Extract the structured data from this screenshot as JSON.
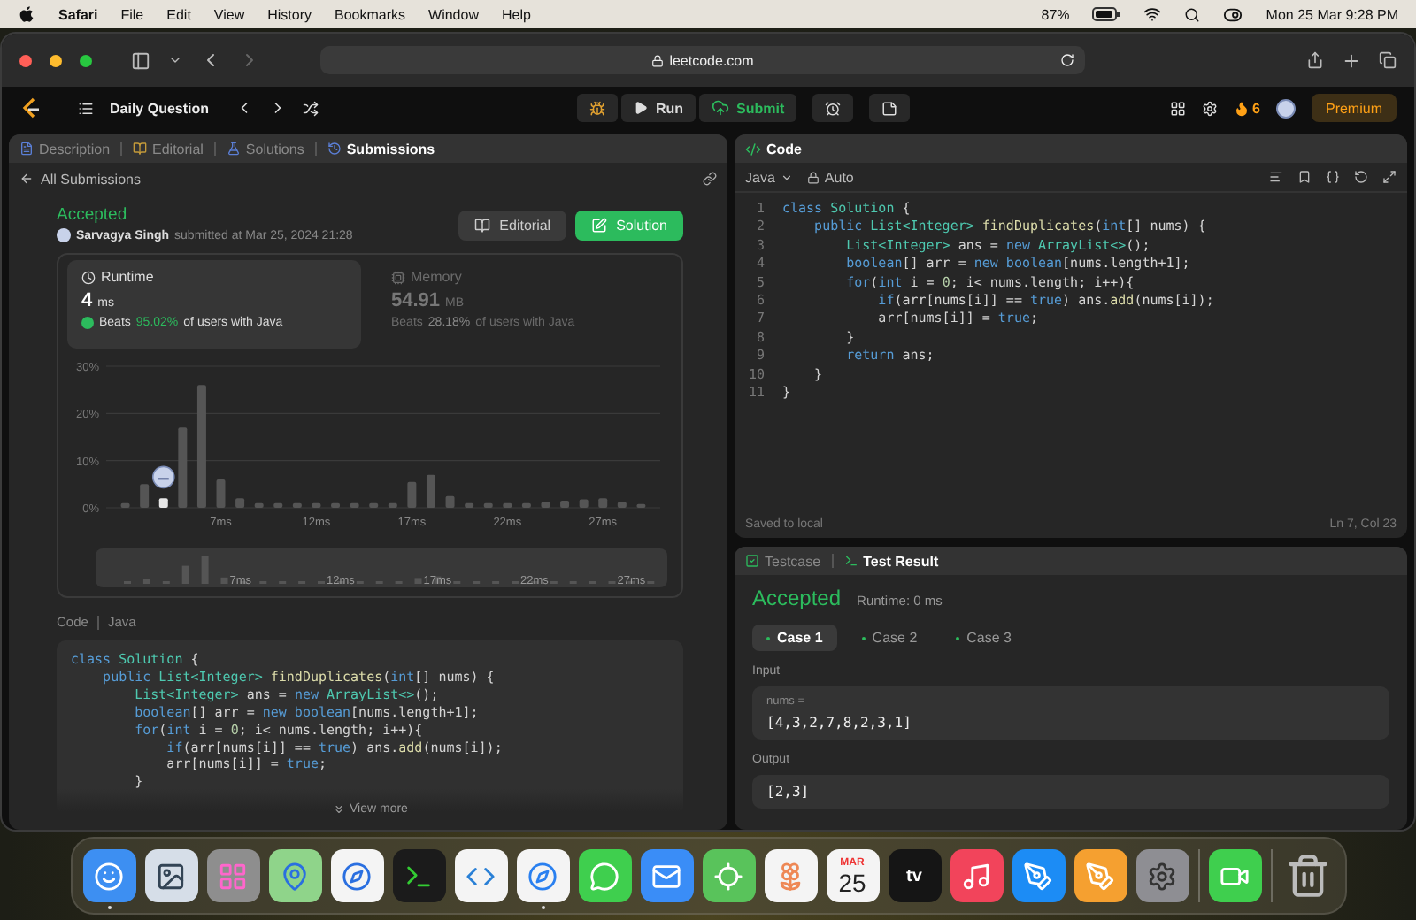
{
  "menu_bar": {
    "app": "Safari",
    "items": [
      "File",
      "Edit",
      "View",
      "History",
      "Bookmarks",
      "Window",
      "Help"
    ],
    "battery": "87%",
    "clock": "Mon 25 Mar  9:28 PM"
  },
  "browser": {
    "url": "leetcode.com"
  },
  "nav": {
    "title": "Daily Question",
    "run": "Run",
    "submit": "Submit",
    "streak": "6",
    "premium": "Premium"
  },
  "left_tabs": [
    {
      "label": "Description",
      "kind": "description",
      "selected": false
    },
    {
      "label": "Editorial",
      "kind": "editorial",
      "selected": false
    },
    {
      "label": "Solutions",
      "kind": "solutions",
      "selected": false
    },
    {
      "label": "Submissions",
      "kind": "submissions",
      "selected": true
    }
  ],
  "back_link": "All Submissions",
  "submission": {
    "status": "Accepted",
    "author": "Sarvagya Singh",
    "submitted": "submitted at Mar 25, 2024 21:28",
    "buttons": [
      {
        "label": "Editorial",
        "kind": "editorial"
      },
      {
        "label": "Solution",
        "kind": "solution"
      }
    ]
  },
  "metrics": [
    {
      "kind": "runtime",
      "label": "Runtime",
      "value": "4",
      "unit": "ms",
      "beats_label": "Beats",
      "beats": "95.02%",
      "suffix": "of users with Java",
      "selected": true
    },
    {
      "kind": "memory",
      "label": "Memory",
      "value": "54.91",
      "unit": "MB",
      "beats_label": "Beats",
      "beats": "28.18%",
      "suffix": "of users with Java",
      "selected": false
    }
  ],
  "chart_data": {
    "type": "bar",
    "x": [
      2,
      3,
      4,
      5,
      6,
      7,
      8,
      9,
      10,
      11,
      12,
      13,
      14,
      15,
      16,
      17,
      18,
      19,
      20,
      21,
      22,
      23,
      24,
      25,
      26,
      27,
      28,
      29
    ],
    "values": [
      1,
      5,
      2,
      17,
      26,
      6,
      2,
      1,
      1,
      1,
      1,
      1,
      1,
      1,
      1,
      5.5,
      7,
      2.5,
      1,
      1,
      1,
      1,
      1.2,
      1.5,
      1.8,
      2,
      1.2,
      0.8
    ],
    "xlim": [
      1,
      30
    ],
    "ylim": [
      0,
      30
    ],
    "yticks": [
      {
        "value": 0,
        "label": "0%"
      },
      {
        "value": 10,
        "label": "10%"
      },
      {
        "value": 20,
        "label": "20%"
      },
      {
        "value": 30,
        "label": "30%"
      }
    ],
    "xticks": [
      {
        "value": 7,
        "label": "7ms"
      },
      {
        "value": 12,
        "label": "12ms"
      },
      {
        "value": 17,
        "label": "17ms"
      },
      {
        "value": 22,
        "label": "22ms"
      },
      {
        "value": 27,
        "label": "27ms"
      }
    ]
  },
  "overview_labels": [
    "7ms",
    "12ms",
    "17ms",
    "22ms",
    "27ms"
  ],
  "code_preview": {
    "label": "Code",
    "language": "Java",
    "view_more": "View more",
    "lines": [
      [
        {
          "kind": "kw",
          "text": "class "
        },
        {
          "kind": "type",
          "text": "Solution"
        },
        {
          "kind": "p",
          "text": " {"
        }
      ],
      [
        {
          "kind": "kw",
          "text": "    public "
        },
        {
          "kind": "type",
          "text": "List<Integer> "
        },
        {
          "kind": "fn",
          "text": "findDuplicates"
        },
        {
          "kind": "p",
          "text": "("
        },
        {
          "kind": "kw",
          "text": "int"
        },
        {
          "kind": "p",
          "text": "[] nums) {"
        }
      ],
      [
        {
          "kind": "type",
          "text": "        List<Integer>"
        },
        {
          "kind": "p",
          "text": " ans = "
        },
        {
          "kind": "kw",
          "text": "new "
        },
        {
          "kind": "type",
          "text": "ArrayList<>"
        },
        {
          "kind": "p",
          "text": "();"
        }
      ],
      [
        {
          "kind": "kw",
          "text": "        boolean"
        },
        {
          "kind": "p",
          "text": "[] arr = "
        },
        {
          "kind": "kw",
          "text": "new boolean"
        },
        {
          "kind": "p",
          "text": "[nums.length+1];"
        }
      ],
      [
        {
          "kind": "kw",
          "text": "        for"
        },
        {
          "kind": "p",
          "text": "("
        },
        {
          "kind": "kw",
          "text": "int"
        },
        {
          "kind": "p",
          "text": " i = "
        },
        {
          "kind": "num",
          "text": "0"
        },
        {
          "kind": "p",
          "text": "; i< nums.length; i++){"
        }
      ],
      [
        {
          "kind": "kw",
          "text": "            if"
        },
        {
          "kind": "p",
          "text": "(arr[nums[i]] == "
        },
        {
          "kind": "kw",
          "text": "true"
        },
        {
          "kind": "p",
          "text": ") ans."
        },
        {
          "kind": "fn",
          "text": "add"
        },
        {
          "kind": "p",
          "text": "(nums[i]);"
        }
      ],
      [
        {
          "kind": "p",
          "text": "            arr[nums[i]] = "
        },
        {
          "kind": "kw",
          "text": "true"
        },
        {
          "kind": "p",
          "text": ";"
        }
      ],
      [
        {
          "kind": "p",
          "text": "        }"
        }
      ]
    ]
  },
  "editor": {
    "title": "Code",
    "language": "Java",
    "mode": "Auto",
    "saved": "Saved to local",
    "cursor": "Ln 7, Col 23",
    "lines": [
      {
        "no": "1",
        "tokens": [
          {
            "kind": "kw",
            "text": "class "
          },
          {
            "kind": "type",
            "text": "Solution"
          },
          {
            "kind": "p",
            "text": " {"
          }
        ]
      },
      {
        "no": "2",
        "tokens": [
          {
            "kind": "kw",
            "text": "    public "
          },
          {
            "kind": "type",
            "text": "List<Integer> "
          },
          {
            "kind": "fn",
            "text": "findDuplicates"
          },
          {
            "kind": "p",
            "text": "("
          },
          {
            "kind": "kw",
            "text": "int"
          },
          {
            "kind": "p",
            "text": "[] nums) {"
          }
        ]
      },
      {
        "no": "3",
        "tokens": [
          {
            "kind": "type",
            "text": "        List<Integer>"
          },
          {
            "kind": "p",
            "text": " ans = "
          },
          {
            "kind": "kw",
            "text": "new "
          },
          {
            "kind": "type",
            "text": "ArrayList<>"
          },
          {
            "kind": "p",
            "text": "();"
          }
        ]
      },
      {
        "no": "4",
        "tokens": [
          {
            "kind": "kw",
            "text": "        boolean"
          },
          {
            "kind": "p",
            "text": "[] arr = "
          },
          {
            "kind": "kw",
            "text": "new boolean"
          },
          {
            "kind": "p",
            "text": "[nums.length+1];"
          }
        ]
      },
      {
        "no": "5",
        "tokens": [
          {
            "kind": "kw",
            "text": "        for"
          },
          {
            "kind": "p",
            "text": "("
          },
          {
            "kind": "kw",
            "text": "int"
          },
          {
            "kind": "p",
            "text": " i = "
          },
          {
            "kind": "num",
            "text": "0"
          },
          {
            "kind": "p",
            "text": "; i< nums.length; i++){"
          }
        ]
      },
      {
        "no": "6",
        "tokens": [
          {
            "kind": "kw",
            "text": "            if"
          },
          {
            "kind": "p",
            "text": "(arr[nums[i]] == "
          },
          {
            "kind": "kw",
            "text": "true"
          },
          {
            "kind": "p",
            "text": ") ans."
          },
          {
            "kind": "fn",
            "text": "add"
          },
          {
            "kind": "p",
            "text": "(nums[i]);"
          }
        ]
      },
      {
        "no": "7",
        "tokens": [
          {
            "kind": "p",
            "text": "            arr[nums[i]] = "
          },
          {
            "kind": "kw",
            "text": "true"
          },
          {
            "kind": "p",
            "text": ";"
          }
        ]
      },
      {
        "no": "8",
        "tokens": [
          {
            "kind": "p",
            "text": "        }"
          }
        ]
      },
      {
        "no": "9",
        "tokens": [
          {
            "kind": "kw",
            "text": "        return"
          },
          {
            "kind": "p",
            "text": " ans;"
          }
        ]
      },
      {
        "no": "10",
        "tokens": [
          {
            "kind": "p",
            "text": "    }"
          }
        ]
      },
      {
        "no": "11",
        "tokens": [
          {
            "kind": "p",
            "text": "}"
          }
        ]
      }
    ]
  },
  "result": {
    "tabs": [
      {
        "label": "Testcase",
        "kind": "testcase",
        "selected": false
      },
      {
        "label": "Test Result",
        "kind": "result",
        "selected": true
      }
    ],
    "status": "Accepted",
    "runtime": "Runtime: 0 ms",
    "cases": [
      {
        "label": "Case 1",
        "selected": true
      },
      {
        "label": "Case 2",
        "selected": false
      },
      {
        "label": "Case 3",
        "selected": false
      }
    ],
    "input_label": "Input",
    "param": "nums =",
    "input": "[4,3,2,7,8,2,3,1]",
    "output_label": "Output",
    "output": "[2,3]"
  },
  "dock": {
    "calendar": {
      "month": "MAR",
      "day": "25"
    },
    "tv": "tv",
    "groups": [
      [
        {
          "kind": "finder",
          "running": true
        },
        {
          "kind": "preview",
          "running": false
        },
        {
          "kind": "launchpad",
          "running": false
        },
        {
          "kind": "maps",
          "running": false
        },
        {
          "kind": "instruments",
          "running": false
        },
        {
          "kind": "terminal",
          "running": false
        },
        {
          "kind": "vscode",
          "running": false
        },
        {
          "kind": "safari",
          "running": true
        },
        {
          "kind": "messages",
          "running": false
        },
        {
          "kind": "mail",
          "running": false
        },
        {
          "kind": "findmy",
          "running": false
        },
        {
          "kind": "photos",
          "running": false
        },
        {
          "kind": "calendar",
          "running": false
        },
        {
          "kind": "tv",
          "running": false
        },
        {
          "kind": "music",
          "running": false
        },
        {
          "kind": "appstore",
          "running": false
        },
        {
          "kind": "pages",
          "running": false
        },
        {
          "kind": "settings",
          "running": false
        }
      ],
      [
        {
          "kind": "facetime",
          "running": false
        }
      ],
      [
        {
          "kind": "trash",
          "running": false
        }
      ]
    ]
  }
}
